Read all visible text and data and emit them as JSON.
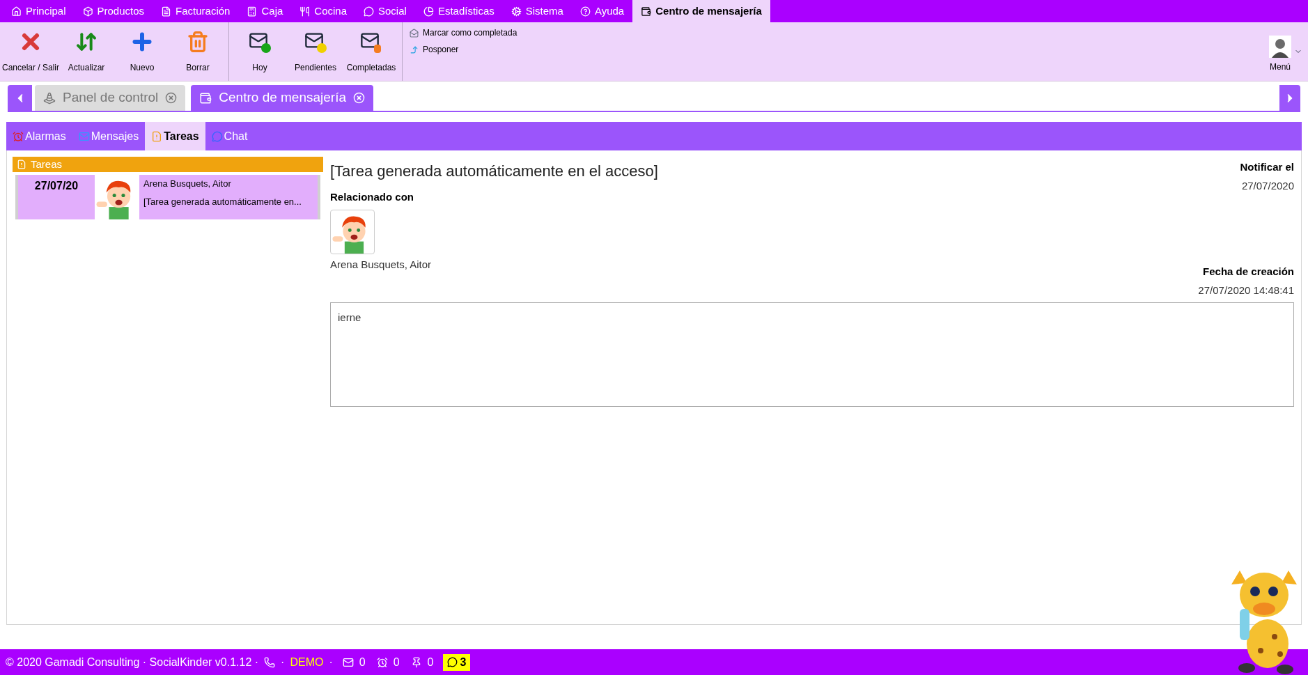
{
  "menu_tabs": [
    {
      "label": "Principal",
      "kind": "home",
      "selected": false
    },
    {
      "label": "Productos",
      "kind": "box",
      "selected": false
    },
    {
      "label": "Facturación",
      "kind": "file",
      "selected": false
    },
    {
      "label": "Caja",
      "kind": "register",
      "selected": false
    },
    {
      "label": "Cocina",
      "kind": "utensils",
      "selected": false
    },
    {
      "label": "Social",
      "kind": "chat",
      "selected": false
    },
    {
      "label": "Estadísticas",
      "kind": "chart",
      "selected": false
    },
    {
      "label": "Sistema",
      "kind": "cogs",
      "selected": false
    },
    {
      "label": "Ayuda",
      "kind": "help",
      "selected": false
    },
    {
      "label": "Centro de mensajería",
      "kind": "messages",
      "selected": true
    }
  ],
  "toolbar": {
    "groups": [
      [
        {
          "label": "Cancelar / Salir",
          "kind": "cancel"
        },
        {
          "label": "Actualizar",
          "kind": "refresh"
        },
        {
          "label": "Nuevo",
          "kind": "new"
        },
        {
          "label": "Borrar",
          "kind": "delete"
        }
      ],
      [
        {
          "label": "Hoy",
          "kind": "mail-today"
        },
        {
          "label": "Pendientes",
          "kind": "mail-pending"
        },
        {
          "label": "Completadas",
          "kind": "mail-done"
        }
      ]
    ],
    "actions": [
      {
        "label": "Marcar como completada",
        "kind": "complete"
      },
      {
        "label": "Posponer",
        "kind": "postpone"
      }
    ],
    "user_menu": {
      "label": "Menú"
    }
  },
  "doc_tabs": [
    {
      "label": "Panel de control",
      "kind": "traffic",
      "selected": false
    },
    {
      "label": "Centro de mensajería",
      "kind": "messages",
      "selected": true
    }
  ],
  "section_tabs": [
    {
      "label": "Alarmas",
      "kind": "alarm",
      "selected": false
    },
    {
      "label": "Mensajes",
      "kind": "mail",
      "selected": false
    },
    {
      "label": "Tareas",
      "kind": "task",
      "selected": true
    },
    {
      "label": "Chat",
      "kind": "chat",
      "selected": false
    }
  ],
  "task_list": {
    "title": "Tareas",
    "items": [
      {
        "date": "27/07/20",
        "name": "Arena Busquets, Aitor",
        "subject": "[Tarea generada automáticamente en...",
        "selected": true
      }
    ]
  },
  "detail": {
    "title": "[Tarea generada automáticamente en el acceso]",
    "notify_label": "Notificar el",
    "notify_date": "27/07/2020",
    "related_label": "Relacionado con",
    "related_name": "Arena Busquets, Aitor",
    "created_label": "Fecha de creación",
    "created_date": "27/07/2020 14:48:41",
    "body": "ierne"
  },
  "status_bar": {
    "copyright": "© 2020 Gamadi Consulting · SocialKinder v0.1.12 ·",
    "separator_1": "·",
    "mode": "DEMO",
    "separator_2": "·",
    "mail_count": "0",
    "alarm_count": "0",
    "pin_count": "0",
    "chat_count": "3"
  }
}
